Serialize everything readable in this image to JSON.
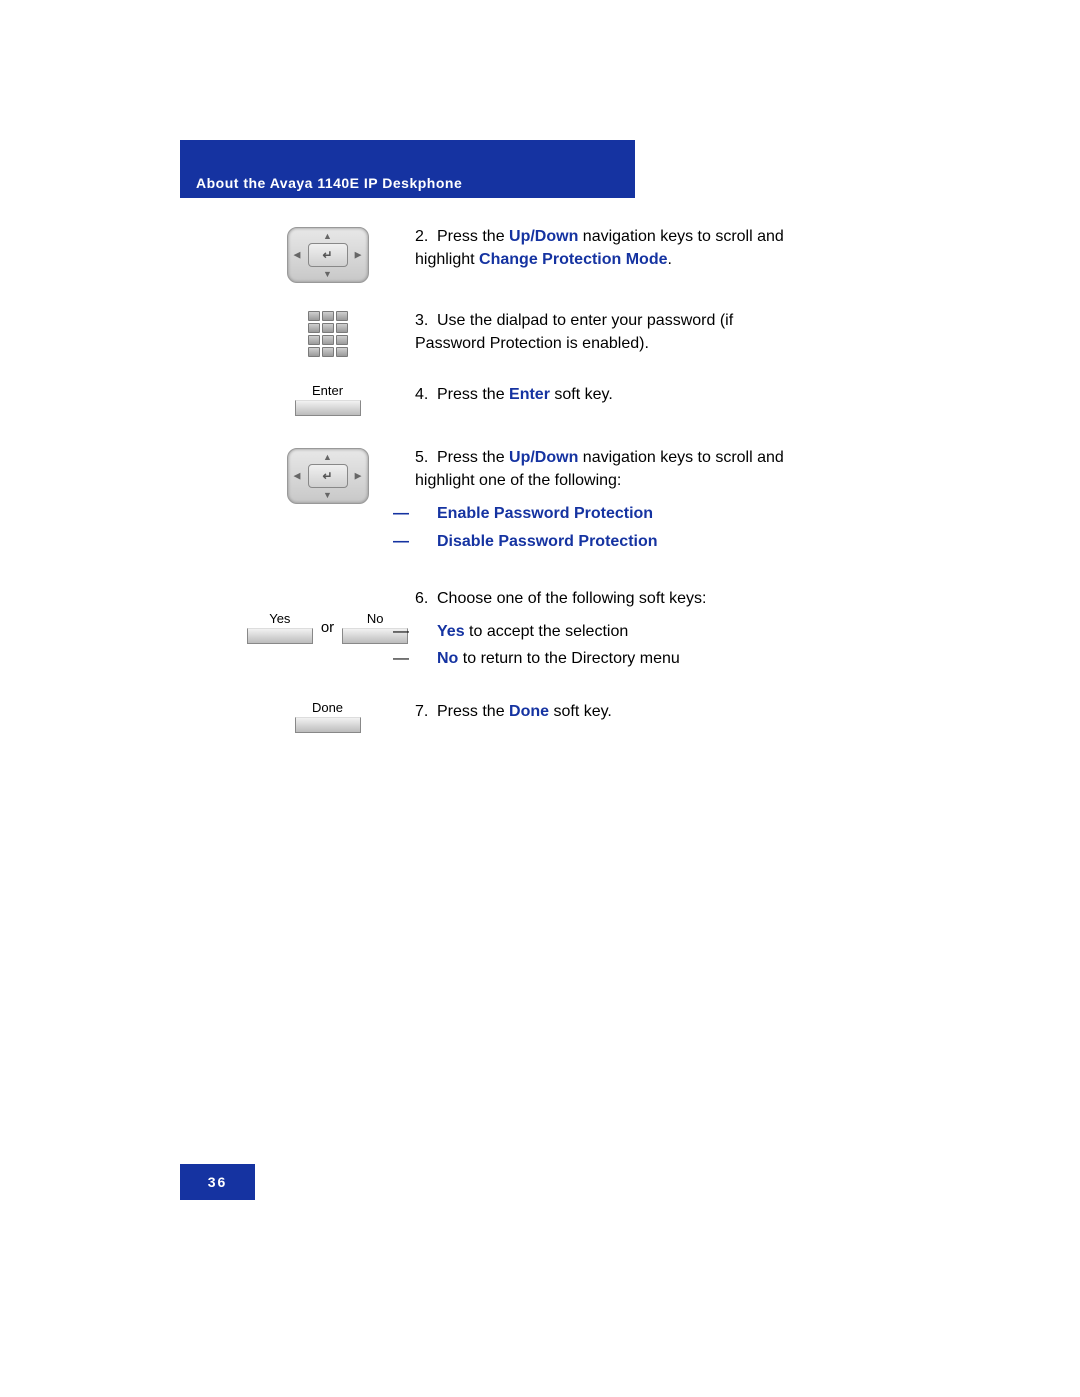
{
  "header": {
    "title": "About the Avaya 1140E IP Deskphone"
  },
  "steps": {
    "s2": {
      "num": "2.",
      "pre": "Press the ",
      "k1": "Up/Down",
      "mid": " navigation keys to scroll and highlight ",
      "k2": "Change Protection Mode",
      "post": "."
    },
    "s3": {
      "num": "3.",
      "text": "Use the dialpad to enter your password (if Password Protection is enabled)."
    },
    "s4": {
      "num": "4.",
      "pre": "Press the ",
      "k1": "Enter",
      "post": " soft key."
    },
    "s5": {
      "num": "5.",
      "pre": "Press the ",
      "k1": "Up/Down",
      "post": " navigation keys to scroll and highlight one of the following:",
      "opt1": "Enable Password Protection",
      "opt2": "Disable Password Protection"
    },
    "s6": {
      "num": "6.",
      "text": "Choose one of the following soft keys:",
      "yes_k": "Yes",
      "yes_t": " to accept the selection",
      "no_k": "No",
      "no_t": " to return to the Directory menu"
    },
    "s7": {
      "num": "7.",
      "pre": "Press the ",
      "k1": "Done",
      "post": " soft key."
    }
  },
  "labels": {
    "enter": "Enter",
    "yes": "Yes",
    "no": "No",
    "done": "Done",
    "or": "or",
    "dash": "—"
  },
  "footer": {
    "page": "36"
  }
}
